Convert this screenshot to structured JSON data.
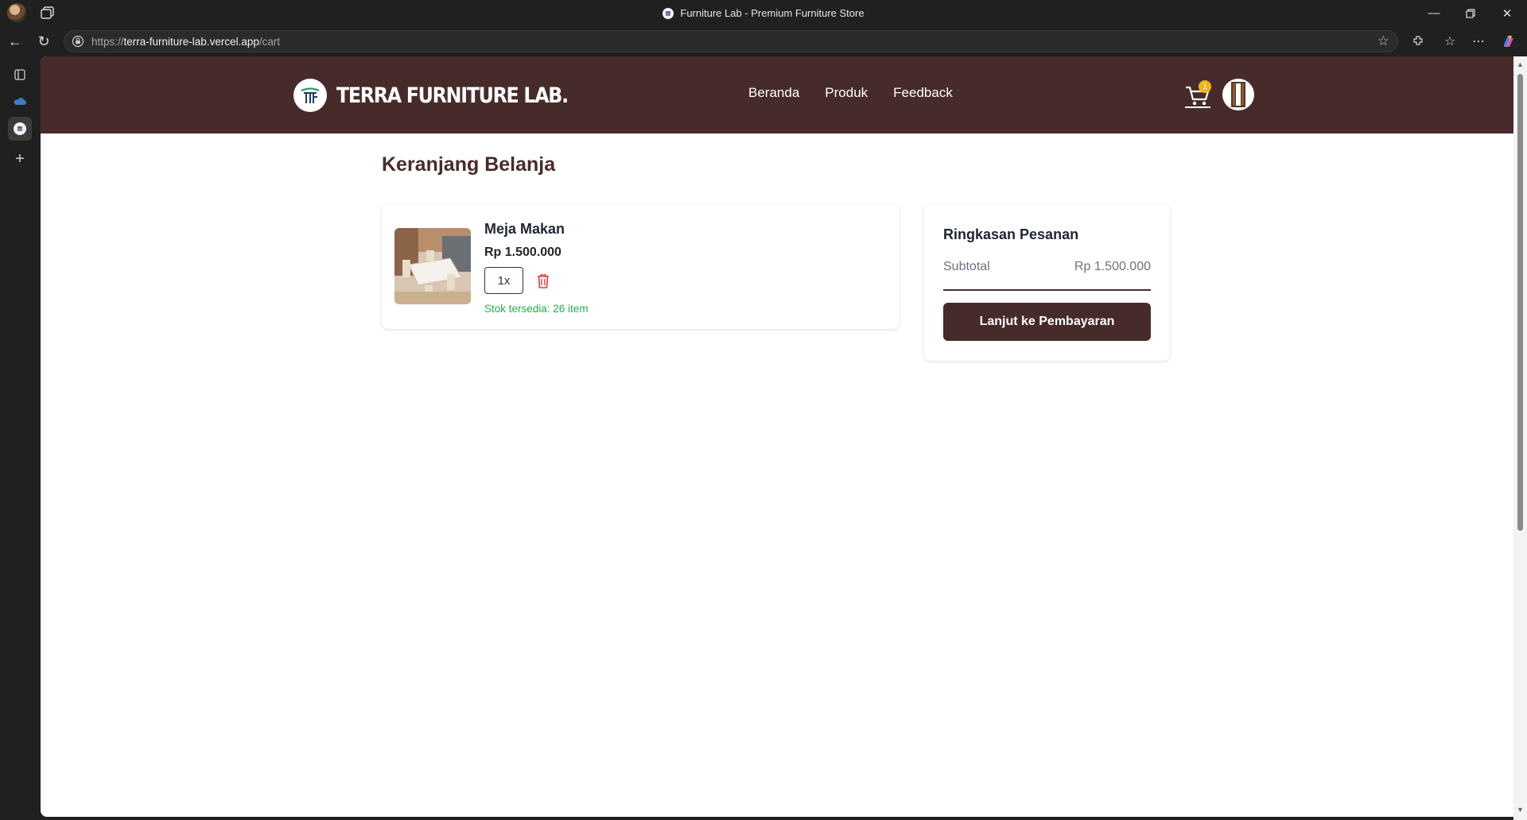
{
  "browser": {
    "tab_title": "Furniture Lab - Premium Furniture Store",
    "url_scheme": "https://",
    "url_host": "terra-furniture-lab.vercel.app",
    "url_path": "/cart"
  },
  "site": {
    "brand": "TERRA FURNITURE LAB.",
    "nav": [
      "Beranda",
      "Produk",
      "Feedback"
    ],
    "cart_count": "1"
  },
  "page": {
    "title": "Keranjang Belanja"
  },
  "cart": {
    "items": [
      {
        "name": "Meja Makan",
        "price": "Rp 1.500.000",
        "quantity": "1x",
        "stock": "Stok tersedia: 26 item"
      }
    ]
  },
  "summary": {
    "title": "Ringkasan Pesanan",
    "subtotal_label": "Subtotal",
    "subtotal_value": "Rp 1.500.000",
    "checkout_label": "Lanjut ke Pembayaran"
  },
  "colors": {
    "brand": "#472b2b",
    "badge": "#f2b31c",
    "stock": "#22b14c",
    "delete": "#e23b3b"
  }
}
